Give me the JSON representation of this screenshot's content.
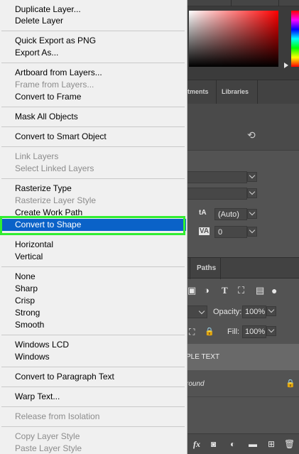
{
  "context_menu": {
    "items": [
      {
        "label": "Duplicate Layer...",
        "enabled": true
      },
      {
        "label": "Delete Layer",
        "enabled": true
      },
      {
        "label": "Quick Export as PNG",
        "enabled": true
      },
      {
        "label": "Export As...",
        "enabled": true
      },
      {
        "label": "Artboard from Layers...",
        "enabled": true
      },
      {
        "label": "Frame from Layers...",
        "enabled": false
      },
      {
        "label": "Convert to Frame",
        "enabled": true
      },
      {
        "label": "Mask All Objects",
        "enabled": true
      },
      {
        "label": "Convert to Smart Object",
        "enabled": true
      },
      {
        "label": "Link Layers",
        "enabled": false
      },
      {
        "label": "Select Linked Layers",
        "enabled": false
      },
      {
        "label": "Rasterize Type",
        "enabled": true
      },
      {
        "label": "Rasterize Layer Style",
        "enabled": false
      },
      {
        "label": "Create Work Path",
        "enabled": true
      },
      {
        "label": "Convert to Shape",
        "enabled": true,
        "highlighted": true
      },
      {
        "label": "Horizontal",
        "enabled": true
      },
      {
        "label": "Vertical",
        "enabled": true
      },
      {
        "label": "None",
        "enabled": true
      },
      {
        "label": "Sharp",
        "enabled": true
      },
      {
        "label": "Crisp",
        "enabled": true
      },
      {
        "label": "Strong",
        "enabled": true
      },
      {
        "label": "Smooth",
        "enabled": true
      },
      {
        "label": "Windows LCD",
        "enabled": true
      },
      {
        "label": "Windows",
        "enabled": true
      },
      {
        "label": "Convert to Paragraph Text",
        "enabled": true
      },
      {
        "label": "Warp Text...",
        "enabled": true
      },
      {
        "label": "Release from Isolation",
        "enabled": false
      },
      {
        "label": "Copy Layer Style",
        "enabled": false
      },
      {
        "label": "Paste Layer Style",
        "enabled": false
      }
    ],
    "highlight_color": "#0a62c8",
    "annotation_color": "#31ee31"
  },
  "panels": {
    "tabs_top": {
      "adjustments_fragment": "tments",
      "libraries": "Libraries"
    },
    "character": {
      "leading_value": "(Auto)",
      "tracking_value": "0",
      "leading_icon_text": "tA",
      "tracking_icon_text": "VA"
    },
    "tabs_layers": {
      "paths": "Paths"
    },
    "layers": {
      "opacity_label": "Opacity:",
      "opacity_value": "100%",
      "fill_label": "Fill:",
      "fill_value": "100%",
      "selected_layer_text": "PLE TEXT",
      "second_layer_text": "round",
      "fx_label": "fx"
    }
  }
}
